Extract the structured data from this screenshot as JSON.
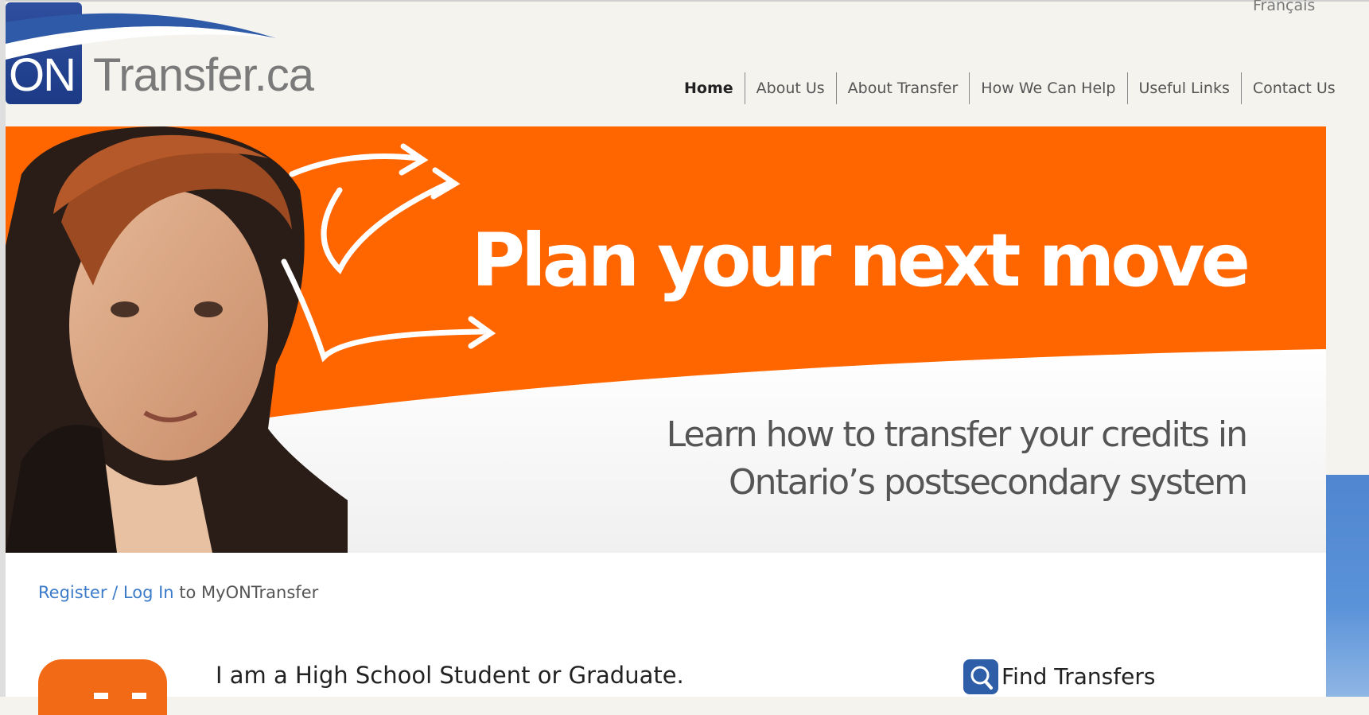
{
  "logo": {
    "on": "ON",
    "transfer": "Transfer.ca"
  },
  "language_link": "Français",
  "nav": {
    "items": [
      {
        "label": "Home"
      },
      {
        "label": "About Us"
      },
      {
        "label": "About Transfer"
      },
      {
        "label": "How We Can Help"
      },
      {
        "label": "Useful Links"
      },
      {
        "label": "Contact Us"
      }
    ]
  },
  "hero": {
    "title": "Plan your next move",
    "subtitle": "Learn how to transfer your credits in Ontario’s postsecondary system"
  },
  "register": {
    "register": "Register",
    "separator": " / ",
    "login": "Log In",
    "suffix": " to MyONTransfer"
  },
  "student_section": {
    "heading": "I am a High School Student or Graduate."
  },
  "find_transfers": {
    "title": "Find Transfers",
    "icon": "search-icon"
  },
  "colors": {
    "orange": "#ff6600",
    "blue": "#2f5ea8",
    "accent_blue": "#3b7bc9"
  }
}
